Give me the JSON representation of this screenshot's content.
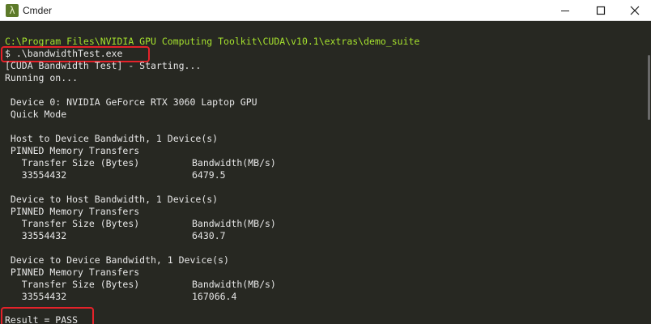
{
  "window": {
    "title": "Cmder",
    "icon": "lambda-icon",
    "icon_glyph": "λ",
    "controls": [
      "minimize-icon",
      "maximize-icon",
      "close-icon"
    ]
  },
  "terminal": {
    "path": "C:\\Program Files\\NVIDIA GPU Computing Toolkit\\CUDA\\v10.1\\extras\\demo_suite",
    "command": "$ .\\bandwidthTest.exe",
    "starting": "[CUDA Bandwidth Test] - Starting...",
    "running_on": "Running on...",
    "device": " Device 0: NVIDIA GeForce RTX 3060 Laptop GPU",
    "mode": " Quick Mode",
    "sections": [
      {
        "title": " Host to Device Bandwidth, 1 Device(s)",
        "memory": " PINNED Memory Transfers",
        "header_size": "   Transfer Size (Bytes)",
        "header_bw": "Bandwidth(MB/s)",
        "size": "   33554432",
        "bw": "6479.5"
      },
      {
        "title": " Device to Host Bandwidth, 1 Device(s)",
        "memory": " PINNED Memory Transfers",
        "header_size": "   Transfer Size (Bytes)",
        "header_bw": "Bandwidth(MB/s)",
        "size": "   33554432",
        "bw": "6430.7"
      },
      {
        "title": " Device to Device Bandwidth, 1 Device(s)",
        "memory": " PINNED Memory Transfers",
        "header_size": "   Transfer Size (Bytes)",
        "header_bw": "Bandwidth(MB/s)",
        "size": "   33554432",
        "bw": "167066.4"
      }
    ],
    "result": "Result = PASS"
  },
  "colors": {
    "background": "#272822",
    "text": "#e6e6e6",
    "path": "#a6e22e",
    "highlight": "#e5222a"
  }
}
